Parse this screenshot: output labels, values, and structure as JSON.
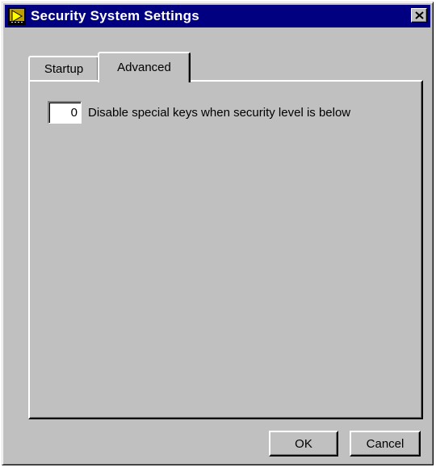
{
  "window": {
    "title": "Security System Settings",
    "close_label": "✕",
    "titlebar_color": "#000080",
    "face_color": "#c0c0c0"
  },
  "tabs": [
    {
      "label": "Startup",
      "selected": false
    },
    {
      "label": "Advanced",
      "selected": true
    }
  ],
  "advanced": {
    "security_level_value": "0",
    "security_level_label": "Disable special keys when security level is below"
  },
  "buttons": {
    "ok_label": "OK",
    "cancel_label": "Cancel"
  },
  "icons": {
    "app": "app-icon",
    "close": "close-icon"
  }
}
